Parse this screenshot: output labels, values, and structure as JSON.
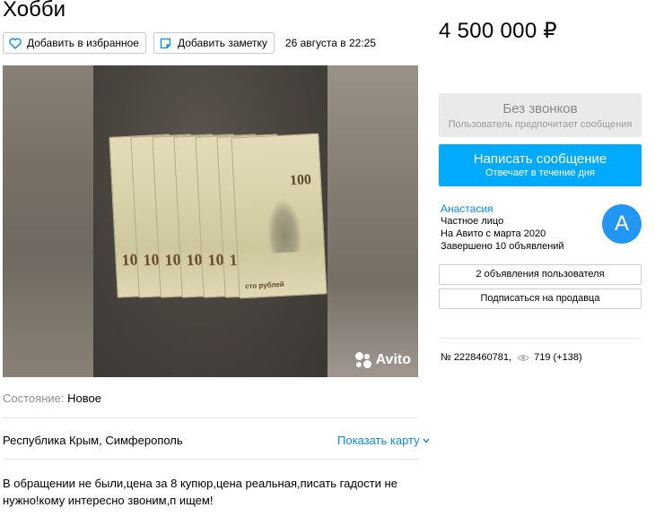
{
  "title": "Хобби",
  "actions": {
    "favorite_label": "Добавить в избранное",
    "note_label": "Добавить заметку",
    "date": "26 августа в 22:25"
  },
  "price": "4 500 000 ₽",
  "gallery": {
    "note_denomination": "100",
    "note_caption": "сто рублей",
    "watermark": "Avito"
  },
  "condition": {
    "label": "Состояние:",
    "value": "Новое"
  },
  "location": {
    "address": "Республика Крым, Симферополь",
    "map_link": "Показать карту"
  },
  "description": "В обращении не были,цена за 8 купюр,цена реальная,писать гадости не нужно!кому интересно звоним,п ищем!",
  "contact": {
    "no_calls_title": "Без звонков",
    "no_calls_sub": "Пользователь предпочитает сообщения",
    "message_title": "Написать сообщение",
    "message_sub": "Отвечает в течение дня"
  },
  "seller": {
    "name": "Анастасия",
    "type": "Частное лицо",
    "since": "На Авито с марта 2020",
    "completed": "Завершено 10 объявлений",
    "avatar_letter": "А",
    "avatar_color": "#2196f3"
  },
  "seller_buttons": {
    "listings": "2 объявления пользователя",
    "subscribe": "Подписаться на продавца"
  },
  "stats": {
    "ad_number": "№ 2228460781,",
    "views": "719 (+138)"
  },
  "colors": {
    "accent": "#00aaff",
    "link": "#0a8adf"
  }
}
